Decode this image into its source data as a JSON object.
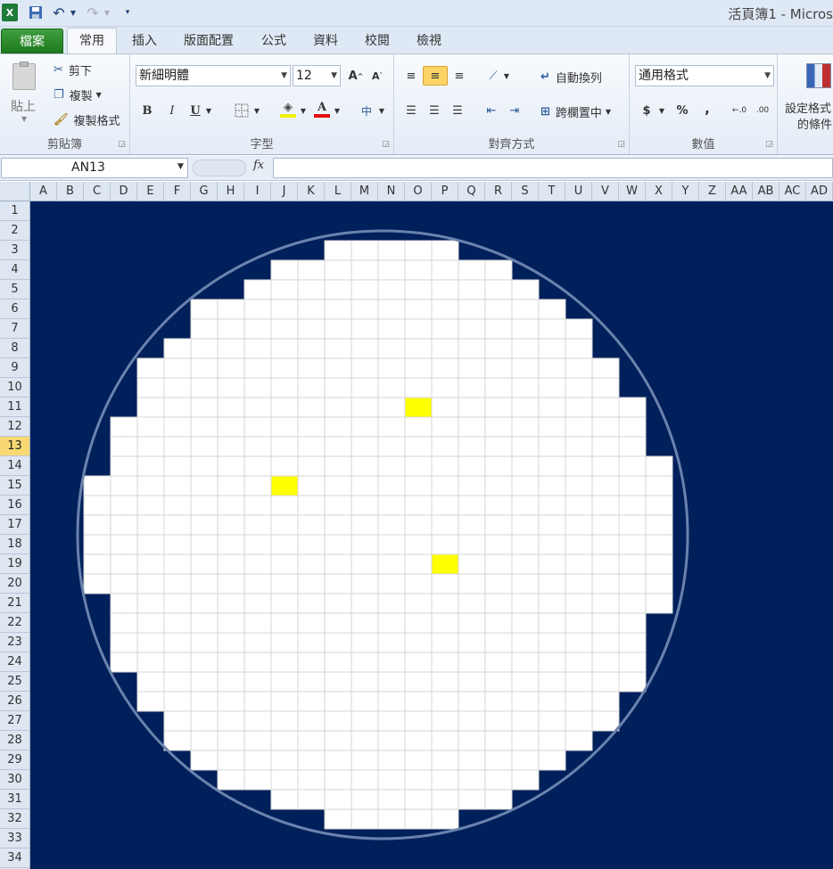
{
  "title_bar": {
    "title": "活頁簿1 - Micros"
  },
  "tabs": [
    "檔案",
    "常用",
    "插入",
    "版面配置",
    "公式",
    "資料",
    "校閱",
    "檢視"
  ],
  "ribbon": {
    "clipboard": {
      "paste": "貼上",
      "cut": "剪下",
      "copy": "複製",
      "format_painter": "複製格式",
      "label": "剪貼簿"
    },
    "font": {
      "font_name": "新細明體",
      "font_size": "12",
      "label": "字型",
      "bold": "B",
      "italic": "I",
      "underline": "U"
    },
    "alignment": {
      "wrap_text": "自動換列",
      "merge_center": "跨欄置中",
      "label": "對齊方式"
    },
    "number": {
      "format": "通用格式",
      "currency": "$",
      "percent": "%",
      "comma": ",",
      "label": "數值"
    },
    "styles": {
      "conditional_line1": "設定格式",
      "conditional_line2": "的條件"
    }
  },
  "formula_bar": {
    "name_box": "AN13",
    "fx": "fx",
    "formula": ""
  },
  "sheet": {
    "columns": [
      "A",
      "B",
      "C",
      "D",
      "E",
      "F",
      "G",
      "H",
      "I",
      "J",
      "K",
      "L",
      "M",
      "N",
      "O",
      "P",
      "Q",
      "R",
      "S",
      "T",
      "U",
      "V",
      "W",
      "X",
      "Y",
      "Z",
      "AA",
      "AB",
      "AC",
      "AD"
    ],
    "rows": [
      "1",
      "2",
      "3",
      "4",
      "5",
      "6",
      "7",
      "8",
      "9",
      "10",
      "11",
      "12",
      "13",
      "14",
      "15",
      "16",
      "17",
      "18",
      "19",
      "20",
      "21",
      "22",
      "23",
      "24",
      "25",
      "26",
      "27",
      "28",
      "29",
      "30",
      "31",
      "32",
      "33",
      "34"
    ],
    "active_row": "13",
    "colors": {
      "background": "#00205B",
      "die": "#FFFFFF",
      "defect": "#FFFF00",
      "ring": "#6A83AE"
    },
    "wafer_rows": [
      {
        "row": 3,
        "from": "L",
        "to": "P"
      },
      {
        "row": 4,
        "from": "J",
        "to": "R"
      },
      {
        "row": 5,
        "from": "I",
        "to": "S"
      },
      {
        "row": 6,
        "from": "G",
        "to": "T"
      },
      {
        "row": 7,
        "from": "G",
        "to": "U"
      },
      {
        "row": 8,
        "from": "F",
        "to": "U"
      },
      {
        "row": 9,
        "from": "E",
        "to": "V"
      },
      {
        "row": 10,
        "from": "E",
        "to": "V"
      },
      {
        "row": 11,
        "from": "E",
        "to": "W"
      },
      {
        "row": 12,
        "from": "D",
        "to": "W"
      },
      {
        "row": 13,
        "from": "D",
        "to": "W"
      },
      {
        "row": 14,
        "from": "D",
        "to": "X"
      },
      {
        "row": 15,
        "from": "C",
        "to": "X"
      },
      {
        "row": 16,
        "from": "C",
        "to": "X"
      },
      {
        "row": 17,
        "from": "C",
        "to": "X"
      },
      {
        "row": 18,
        "from": "C",
        "to": "X"
      },
      {
        "row": 19,
        "from": "C",
        "to": "X"
      },
      {
        "row": 20,
        "from": "C",
        "to": "X"
      },
      {
        "row": 21,
        "from": "D",
        "to": "X"
      },
      {
        "row": 22,
        "from": "D",
        "to": "W"
      },
      {
        "row": 23,
        "from": "D",
        "to": "W"
      },
      {
        "row": 24,
        "from": "D",
        "to": "W"
      },
      {
        "row": 25,
        "from": "E",
        "to": "W"
      },
      {
        "row": 26,
        "from": "E",
        "to": "V"
      },
      {
        "row": 27,
        "from": "F",
        "to": "V"
      },
      {
        "row": 28,
        "from": "F",
        "to": "U"
      },
      {
        "row": 29,
        "from": "G",
        "to": "T"
      },
      {
        "row": 30,
        "from": "H",
        "to": "S"
      },
      {
        "row": 31,
        "from": "J",
        "to": "R"
      },
      {
        "row": 32,
        "from": "L",
        "to": "P"
      }
    ],
    "defects": [
      {
        "row": 11,
        "col": "O"
      },
      {
        "row": 15,
        "col": "J"
      },
      {
        "row": 19,
        "col": "P"
      }
    ]
  }
}
